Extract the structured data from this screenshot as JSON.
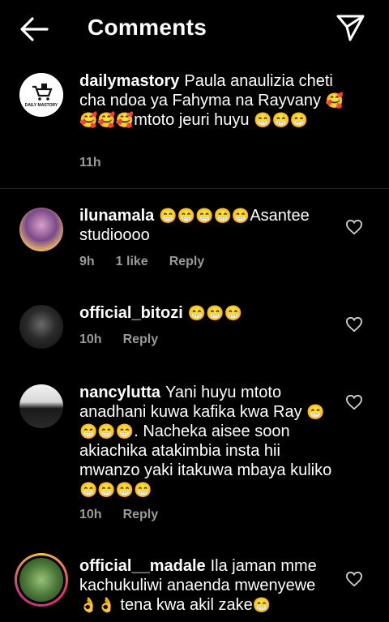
{
  "header": {
    "title": "Comments"
  },
  "caption": {
    "username": "dailymastory",
    "text": "Paula anaulizia cheti cha ndoa ya Fahyma na Rayvany ",
    "emoji1": "🥰🥰🥰🥰",
    "text2": "mtoto jeuri huyu ",
    "emoji2": "😁😁😁",
    "time": "11h",
    "avatar_text": "DAILY MASTORY"
  },
  "comments": [
    {
      "username": "ilunamala",
      "emoji_pre": "😁😁😁😁😁",
      "text": "Asantee studioooo",
      "emoji_post": "",
      "time": "9h",
      "likes": "1 like",
      "reply": "Reply"
    },
    {
      "username": "official_bitozi",
      "emoji_pre": "😁😁😁",
      "text": "",
      "emoji_post": "",
      "time": "10h",
      "likes": "",
      "reply": "Reply"
    },
    {
      "username": "nancylutta",
      "text_a": "Yani huyu mtoto anadhani kuwa kafika kwa Ray ",
      "emoji_a": "😁😁😁😁",
      "text_b": ". Nacheka aisee soon akiachika atakimbia insta hii mwanzo yaki itakuwa mbaya kuliko",
      "emoji_b": "😁😁😁😁",
      "time": "10h",
      "reply": "Reply"
    },
    {
      "username": "official__madale",
      "text_a": "Ila jaman mme kachukuliwi anaenda mwenyewe ",
      "emoji_a": "👌👌",
      "text_b": " tena kwa akil zake",
      "emoji_b": "😁"
    }
  ]
}
